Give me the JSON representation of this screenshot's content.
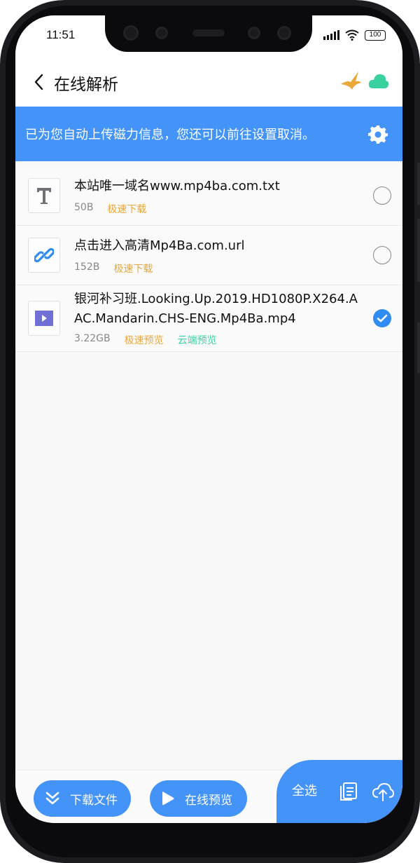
{
  "status_bar": {
    "time": "11:51",
    "battery": "100"
  },
  "header": {
    "title": "在线解析"
  },
  "banner": {
    "text": "已为您自动上传磁力信息，您还可以前往设置取消。"
  },
  "files": [
    {
      "name": "本站唯一域名www.mp4ba.com.txt",
      "size": "50B",
      "actions": [
        "极速下载"
      ],
      "selected": false,
      "icon": "text-file-icon"
    },
    {
      "name": "点击进入高清Mp4Ba.com.url",
      "size": "152B",
      "actions": [
        "极速下载"
      ],
      "selected": false,
      "icon": "link-file-icon"
    },
    {
      "name": "银河补习班.Looking.Up.2019.HD1080P.X264.AAC.Mandarin.CHS-ENG.Mp4Ba.mp4",
      "size": "3.22GB",
      "actions": [
        "极速预览",
        "云端预览"
      ],
      "selected": true,
      "icon": "video-file-icon"
    }
  ],
  "bottom_bar": {
    "download_label": "下载文件",
    "preview_label": "在线预览",
    "select_all_label": "全选"
  },
  "colors": {
    "accent": "#4393f8",
    "orange": "#e8a83a",
    "green": "#39d3a5",
    "cloud": "#3ad1a0",
    "bird": "#e8a83a"
  }
}
